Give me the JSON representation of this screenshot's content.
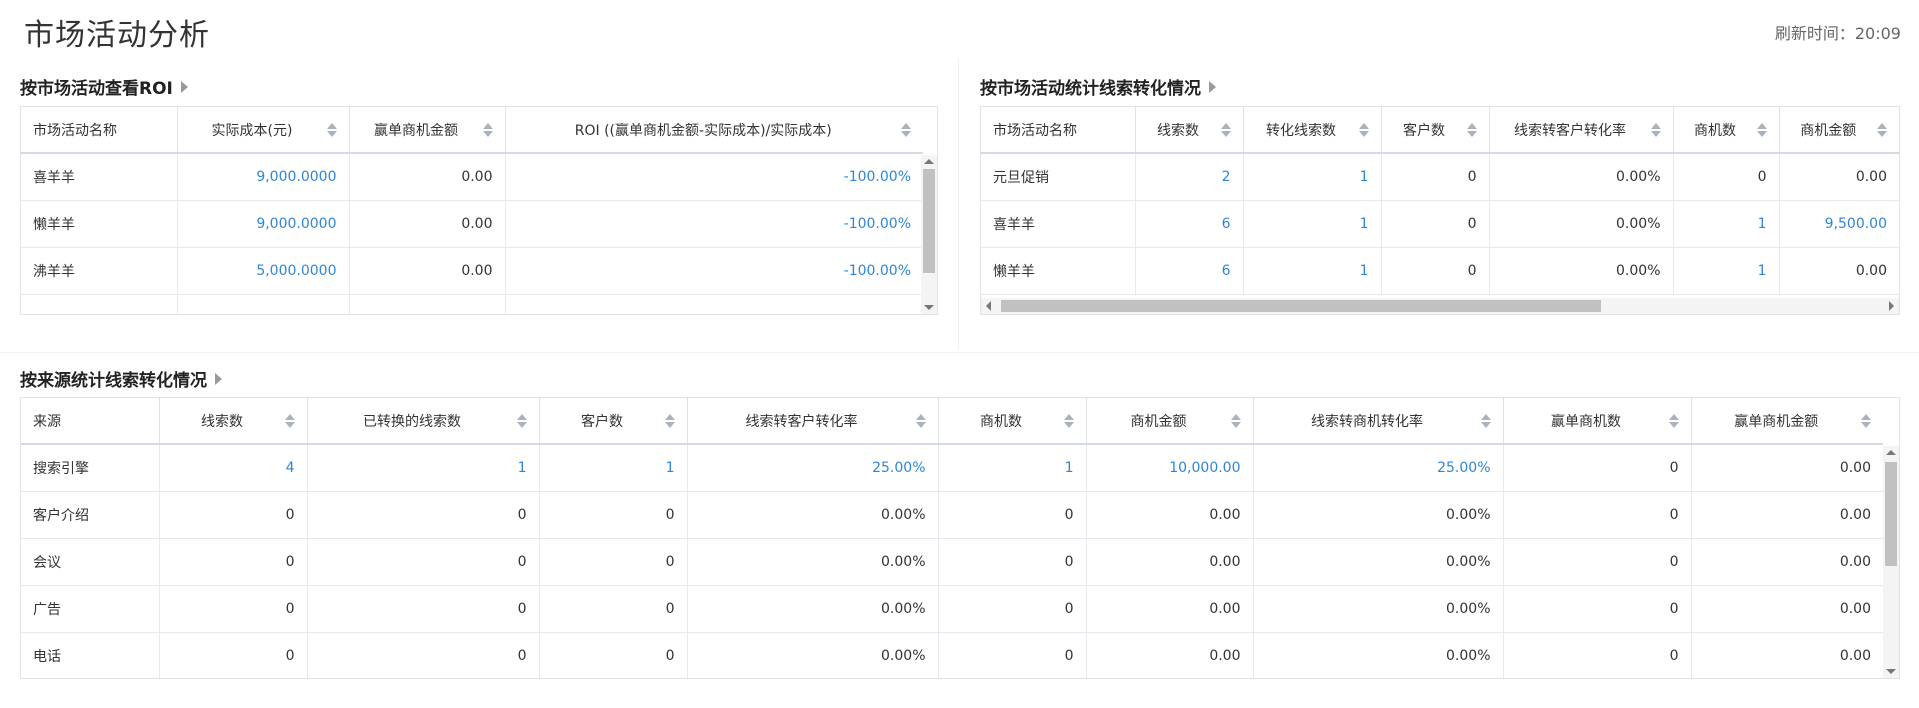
{
  "header": {
    "title": "市场活动分析",
    "refresh_label": "刷新时间：20:09"
  },
  "roi": {
    "title": "按市场活动查看ROI",
    "columns": [
      "市场活动名称",
      "实际成本(元)",
      "赢单商机金额",
      "ROI ((赢单商机金额-实际成本)/实际成本)"
    ],
    "rows": [
      [
        "喜羊羊",
        "9,000.0000",
        "0.00",
        "-100.00%"
      ],
      [
        "懒羊羊",
        "9,000.0000",
        "0.00",
        "-100.00%"
      ],
      [
        "沸羊羊",
        "5,000.0000",
        "0.00",
        "-100.00%"
      ]
    ]
  },
  "activity": {
    "title": "按市场活动统计线索转化情况",
    "columns": [
      "市场活动名称",
      "线索数",
      "转化线索数",
      "客户数",
      "线索转客户转化率",
      "商机数",
      "商机金额"
    ],
    "rows": [
      [
        "元旦促销",
        "2",
        "1",
        "0",
        "0.00%",
        "0",
        "0.00"
      ],
      [
        "喜羊羊",
        "6",
        "1",
        "0",
        "0.00%",
        "1",
        "9,500.00"
      ],
      [
        "懒羊羊",
        "6",
        "1",
        "0",
        "0.00%",
        "1",
        "0.00"
      ]
    ]
  },
  "source": {
    "title": "按来源统计线索转化情况",
    "columns": [
      "来源",
      "线索数",
      "已转换的线索数",
      "客户数",
      "线索转客户转化率",
      "商机数",
      "商机金额",
      "线索转商机转化率",
      "赢单商机数",
      "赢单商机金额"
    ],
    "rows": [
      [
        "搜索引擎",
        "4",
        "1",
        "1",
        "25.00%",
        "1",
        "10,000.00",
        "25.00%",
        "0",
        "0.00"
      ],
      [
        "客户介绍",
        "0",
        "0",
        "0",
        "0.00%",
        "0",
        "0.00",
        "0.00%",
        "0",
        "0.00"
      ],
      [
        "会议",
        "0",
        "0",
        "0",
        "0.00%",
        "0",
        "0.00",
        "0.00%",
        "0",
        "0.00"
      ],
      [
        "广告",
        "0",
        "0",
        "0",
        "0.00%",
        "0",
        "0.00",
        "0.00%",
        "0",
        "0.00"
      ],
      [
        "电话",
        "0",
        "0",
        "0",
        "0.00%",
        "0",
        "0.00",
        "0.00%",
        "0",
        "0.00"
      ]
    ]
  },
  "colors": {
    "link": "#2f86d6",
    "border": "#dfe3e8"
  }
}
